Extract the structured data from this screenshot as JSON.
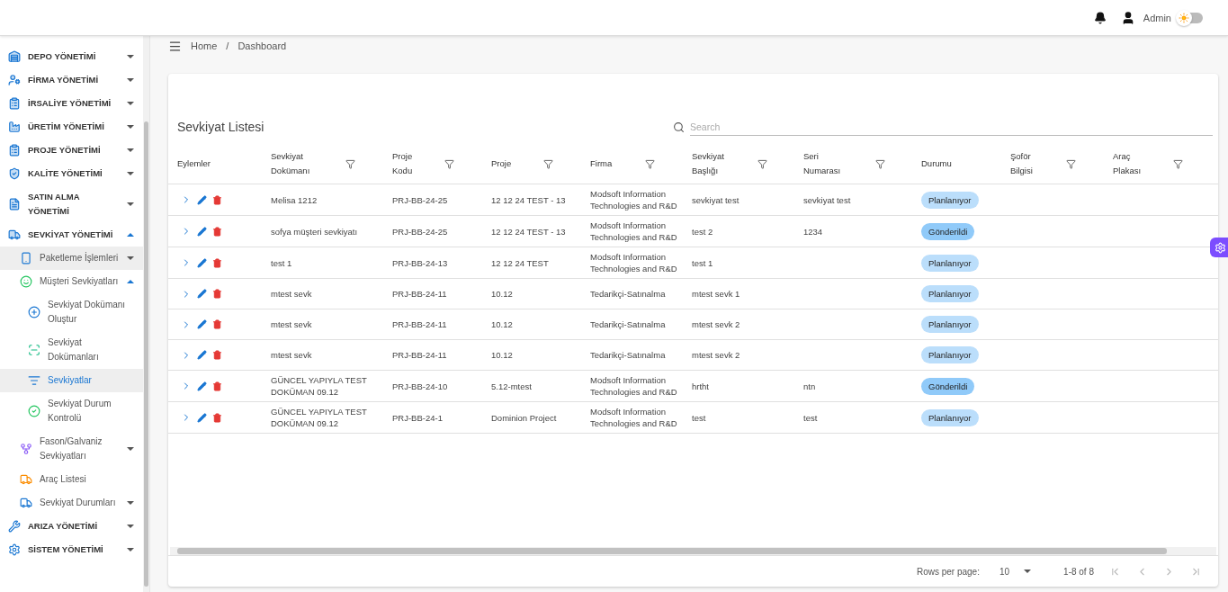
{
  "topbar": {
    "user": "Admin",
    "theme_toggle": {
      "on": false
    }
  },
  "sidebar": {
    "items": [
      {
        "label": "DEPO YÖNETİMİ",
        "kind": "group",
        "expanded": false,
        "selected": false,
        "highlighted": false
      },
      {
        "label": "FİRMA YÖNETİMİ",
        "kind": "group",
        "expanded": false,
        "selected": false,
        "highlighted": false
      },
      {
        "label": "İRSALİYE YÖNETİMİ",
        "kind": "group",
        "expanded": false,
        "selected": false,
        "highlighted": false
      },
      {
        "label": "ÜRETİM YÖNETİMİ",
        "kind": "group",
        "expanded": false,
        "selected": false,
        "highlighted": false
      },
      {
        "label": "PROJE YÖNETİMİ",
        "kind": "group",
        "expanded": false,
        "selected": false,
        "highlighted": false
      },
      {
        "label": "KALİTE YÖNETİMİ",
        "kind": "group",
        "expanded": false,
        "selected": false,
        "highlighted": false
      },
      {
        "label": "SATIN ALMA YÖNETİMİ",
        "kind": "group",
        "expanded": false,
        "selected": false,
        "highlighted": false
      },
      {
        "label": "SEVKİYAT YÖNETİMİ",
        "kind": "group",
        "expanded": true,
        "selected": false,
        "highlighted": false,
        "children": [
          {
            "label": "Paketleme İşlemleri",
            "kind": "group",
            "expanded": false,
            "selected": false,
            "highlighted": true
          },
          {
            "label": "Müşteri Sevkiyatları",
            "kind": "group",
            "expanded": true,
            "selected": false,
            "highlighted": false,
            "children": [
              {
                "label": "Sevkiyat Dokümanı Oluştur",
                "kind": "link",
                "selected": false,
                "highlighted": false
              },
              {
                "label": "Sevkiyat Dokümanları",
                "kind": "link",
                "selected": false,
                "highlighted": false
              },
              {
                "label": "Sevkiyatlar",
                "kind": "link",
                "selected": true,
                "highlighted": false
              },
              {
                "label": "Sevkiyat Durum Kontrolü",
                "kind": "link",
                "selected": false,
                "highlighted": false
              }
            ]
          },
          {
            "label": "Fason/Galvaniz Sevkiyatları",
            "kind": "group",
            "expanded": false,
            "selected": false,
            "highlighted": false
          },
          {
            "label": "Araç Listesi",
            "kind": "link",
            "selected": false,
            "highlighted": false
          },
          {
            "label": "Sevkiyat Durumları",
            "kind": "group",
            "expanded": false,
            "selected": false,
            "highlighted": false
          }
        ]
      },
      {
        "label": "ARIZA YÖNETİMİ",
        "kind": "group",
        "expanded": false,
        "selected": false,
        "highlighted": false
      },
      {
        "label": "SİSTEM YÖNETİMİ",
        "kind": "group",
        "expanded": false,
        "selected": false,
        "highlighted": false
      }
    ]
  },
  "breadcrumb": {
    "items": [
      "Home",
      "Dashboard"
    ],
    "separator": "/"
  },
  "table": {
    "title": "Sevkiyat Listesi",
    "search": {
      "placeholder": "Search"
    },
    "columns": [
      {
        "label": "Eylemler",
        "filter": false
      },
      {
        "label": "Sevkiyat Dokümanı",
        "filter": true
      },
      {
        "label": "Proje Kodu",
        "filter": true
      },
      {
        "label": "Proje",
        "filter": true
      },
      {
        "label": "Firma",
        "filter": true
      },
      {
        "label": "Sevkiyat Başlığı",
        "filter": true
      },
      {
        "label": "Seri Numarası",
        "filter": true
      },
      {
        "label": "Durumu",
        "filter": false
      },
      {
        "label": "Şoför Bilgisi",
        "filter": true
      },
      {
        "label": "Araç Plakası",
        "filter": true
      }
    ],
    "rows": [
      {
        "document": "Melisa 1212",
        "project_code": "PRJ-BB-24-25",
        "project": "12 12 24 TEST - 13",
        "company": "Modsoft Information Technologies and R&D",
        "title": "sevkiyat test",
        "serial": "sevkiyat test",
        "status": {
          "label": "Planlanıyor",
          "color": "#bbdefb"
        }
      },
      {
        "document": "sofya müşteri sevkiyatı",
        "project_code": "PRJ-BB-24-25",
        "project": "12 12 24 TEST - 13",
        "company": "Modsoft Information Technologies and R&D",
        "title": "test 2",
        "serial": "1234",
        "status": {
          "label": "Gönderildi",
          "color": "#90caf9"
        }
      },
      {
        "document": "test 1",
        "project_code": "PRJ-BB-24-13",
        "project": "12 12 24 TEST",
        "company": "Modsoft Information Technologies and R&D",
        "title": "test 1",
        "status": {
          "label": "Planlanıyor",
          "color": "#bbdefb"
        }
      },
      {
        "document": "mtest sevk",
        "project_code": "PRJ-BB-24-11",
        "project": "10.12",
        "company": "Tedarikçi-Satınalma",
        "title": "mtest sevk 1",
        "status": {
          "label": "Planlanıyor",
          "color": "#bbdefb"
        }
      },
      {
        "document": "mtest sevk",
        "project_code": "PRJ-BB-24-11",
        "project": "10.12",
        "company": "Tedarikçi-Satınalma",
        "title": "mtest sevk 2",
        "status": {
          "label": "Planlanıyor",
          "color": "#bbdefb"
        }
      },
      {
        "document": "mtest sevk",
        "project_code": "PRJ-BB-24-11",
        "project": "10.12",
        "company": "Tedarikçi-Satınalma",
        "title": "mtest sevk 2",
        "status": {
          "label": "Planlanıyor",
          "color": "#bbdefb"
        }
      },
      {
        "document": "GÜNCEL YAPIYLA TEST DOKÜMAN 09.12",
        "project_code": "PRJ-BB-24-10",
        "project": "5.12-mtest",
        "company": "Modsoft Information Technologies and R&D",
        "title": "hrtht",
        "serial": "ntn",
        "status": {
          "label": "Gönderildi",
          "color": "#90caf9"
        }
      },
      {
        "document": "GÜNCEL YAPIYLA TEST DOKÜMAN 09.12",
        "project_code": "PRJ-BB-24-1",
        "project": "Dominion Project",
        "company": "Modsoft Information Technologies and R&D",
        "title": "test",
        "serial": "test",
        "status": {
          "label": "Planlanıyor",
          "color": "#bbdefb"
        }
      }
    ],
    "pagination": {
      "rows_label": "Rows per page:",
      "rows_value": "10",
      "range": "1-8 of 8",
      "nav_disabled": true
    }
  }
}
